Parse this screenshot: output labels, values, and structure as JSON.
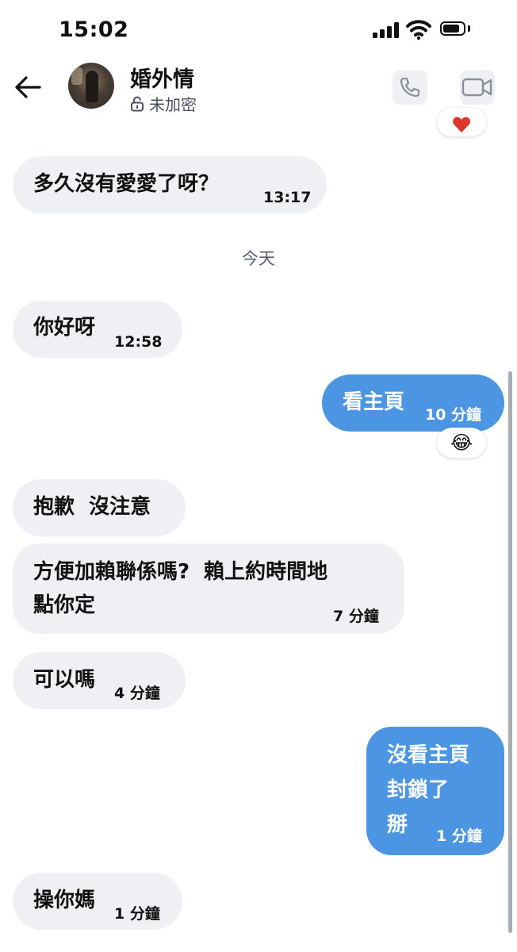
{
  "status_bar": {
    "time": "15:02"
  },
  "header": {
    "contact_name": "婚外情",
    "encryption_status": "未加密",
    "icons": [
      "back-arrow-icon",
      "lock-icon",
      "phone-icon",
      "video-camera-icon"
    ]
  },
  "messages": [
    {
      "side": "in",
      "text": "多久沒有愛愛了呀？",
      "time": "13:17"
    },
    {
      "type": "date_separator",
      "text": "今天"
    },
    {
      "side": "in",
      "text": "你好呀",
      "time": "12:58"
    },
    {
      "side": "out",
      "text": "看主頁",
      "time": "10 分鐘",
      "reaction": "😂"
    },
    {
      "side": "in",
      "text": "抱歉  沒注意",
      "time": ""
    },
    {
      "side": "in",
      "text_line1": "方便加賴聯係嗎?  賴上約時間地",
      "text_line2": "點你定",
      "time": "7 分鐘"
    },
    {
      "side": "in",
      "text": "可以嗎",
      "time": "4 分鐘"
    },
    {
      "side": "out",
      "text_line1": "沒看主頁",
      "text_line2": "封鎖了",
      "text_line3": "掰",
      "time": "1 分鐘"
    },
    {
      "side": "in",
      "text": "操你媽",
      "time": "1 分鐘"
    }
  ],
  "top_reaction": "heart",
  "colors": {
    "incoming_bubble": "#eef0f3",
    "outgoing_bubble": "#4c95e2",
    "heart": "#e0352b"
  }
}
